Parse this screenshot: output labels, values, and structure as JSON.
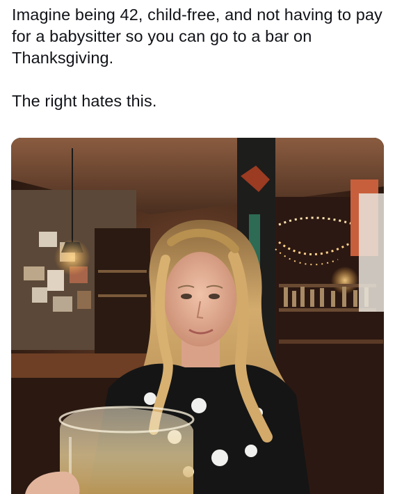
{
  "post": {
    "text_line1": "Imagine being 42, child-free, and not having to pay for a babysitter so you can go to a bar on Thanksgiving.",
    "text_line2": "The right hates this."
  },
  "media": {
    "kind": "photo",
    "colors": {
      "ceiling": "#6b4a35",
      "wall_dark": "#2a1a12",
      "hair": "#c9a064",
      "skin": "#e7b49a",
      "dress": "#141414",
      "glass": "#e9d7a6",
      "light_warm": "#f3b866"
    }
  }
}
